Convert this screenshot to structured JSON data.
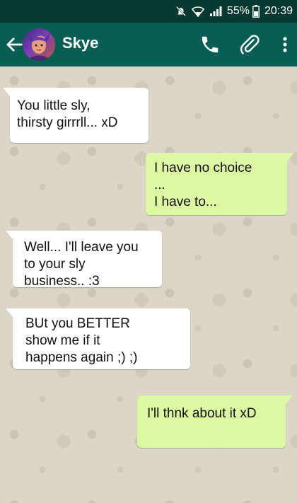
{
  "status_bar": {
    "battery_percent": "55%",
    "time": "20:39",
    "icons": [
      "mute-icon",
      "wifi-icon",
      "signal-icon",
      "battery-icon"
    ]
  },
  "header": {
    "contact_name": "Skye",
    "icons": [
      "back-arrow-icon",
      "avatar",
      "phone-icon",
      "paperclip-icon",
      "more-vert-icon"
    ]
  },
  "colors": {
    "header": "#075e54",
    "status_bar": "#063a31",
    "incoming_bubble": "#ffffff",
    "outgoing_bubble": "#dcf8a0",
    "chat_background": "#dcd6c9"
  },
  "messages": [
    {
      "direction": "incoming",
      "text": "You little sly,\nthirsty girrrll... xD"
    },
    {
      "direction": "outgoing",
      "text": "I have no choice\n...\nI have to..."
    },
    {
      "direction": "incoming",
      "text": "Well... I'll leave you\nto your sly\nbusiness.. :3"
    },
    {
      "direction": "incoming",
      "text": "BUt you BETTER\nshow me if it\nhappens again ;) ;)"
    },
    {
      "direction": "outgoing",
      "text": "I'll thnk about it xD"
    }
  ]
}
